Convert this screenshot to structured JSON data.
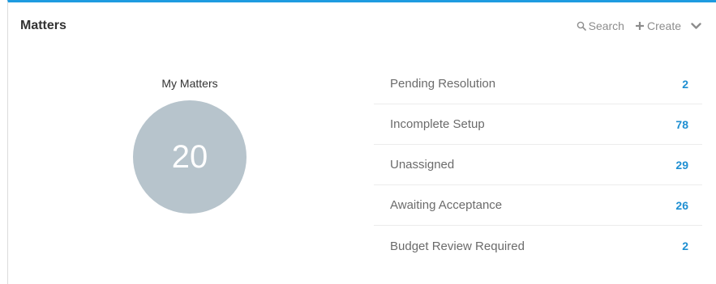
{
  "panel": {
    "title": "Matters",
    "accent_color": "#1e9be0",
    "actions": [
      {
        "icon": "search-icon",
        "label": "Search"
      },
      {
        "icon": "plus-icon",
        "label": "Create"
      }
    ],
    "collapse_icon": "chevron-down-icon"
  },
  "summary": {
    "title": "My Matters",
    "count": "20",
    "circle_color": "#b7c4cc"
  },
  "list": [
    {
      "label": "Pending Resolution",
      "count": "2"
    },
    {
      "label": "Incomplete Setup",
      "count": "78"
    },
    {
      "label": "Unassigned",
      "count": "29"
    },
    {
      "label": "Awaiting Acceptance",
      "count": "26"
    },
    {
      "label": "Budget Review Required",
      "count": "2"
    }
  ]
}
